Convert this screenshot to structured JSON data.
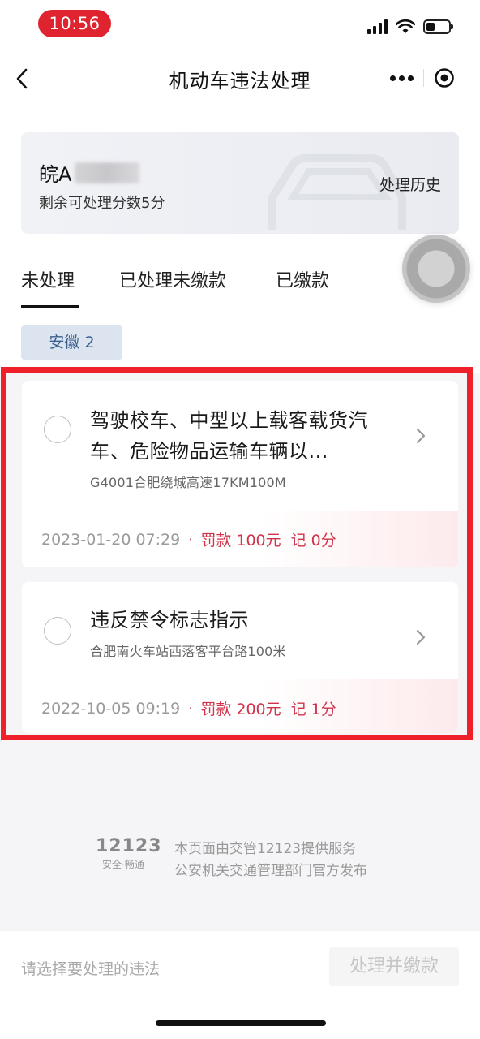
{
  "status_bar": {
    "time": "10:56"
  },
  "nav": {
    "title": "机动车违法处理"
  },
  "plate_card": {
    "plate_prefix": "皖A",
    "points_remaining": "剩余可处理分数5分",
    "history_label": "处理历史"
  },
  "tabs": [
    {
      "label": "未处理",
      "active": true
    },
    {
      "label": "已处理未缴款",
      "active": false
    },
    {
      "label": "已缴款",
      "active": false
    }
  ],
  "region_chip": "安徽 2",
  "violations": [
    {
      "title": "驾驶校车、中型以上载客载货汽车、危险物品运输车辆以...",
      "location": "G4001合肥绕城高速17KM100M",
      "time": "2023-01-20 07:29",
      "separator": "·",
      "fine": "罚款 100元",
      "points": "记 0分"
    },
    {
      "title": "违反禁令标志指示",
      "location": "合肥南火车站西落客平台路100米",
      "time": "2022-10-05 09:19",
      "separator": "·",
      "fine": "罚款 200元",
      "points": "记 1分"
    }
  ],
  "footer": {
    "logo_number": "12123",
    "logo_slogan": "安全·畅通",
    "line1": "本页面由交管12123提供服务",
    "line2": "公安机关交通管理部门官方发布"
  },
  "bottom_bar": {
    "hint": "请选择要处理的违法",
    "pay_button": "处理并缴款"
  },
  "colors": {
    "time_pill": "#e0242f",
    "highlight_border": "#f0202a",
    "fine_text": "#d0324a",
    "region_chip_bg": "#dbe4ef",
    "region_chip_text": "#3a5f8e"
  },
  "icons": [
    "back-chevron-icon",
    "more-dots-icon",
    "close-target-icon",
    "car-outline-icon",
    "chevron-right-icon",
    "floating-ball-icon",
    "signal-icon",
    "wifi-icon",
    "battery-icon"
  ]
}
